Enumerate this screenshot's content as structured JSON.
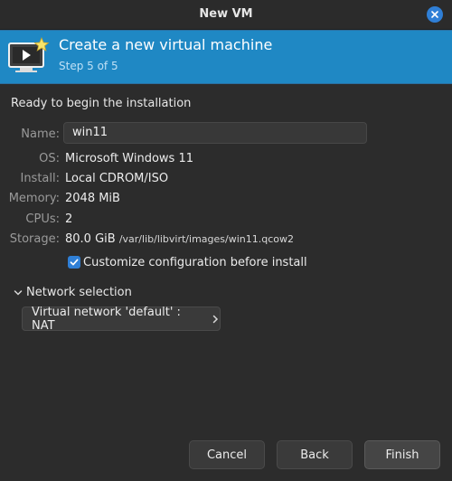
{
  "window": {
    "title": "New VM"
  },
  "banner": {
    "heading": "Create a new virtual machine",
    "step": "Step 5 of 5",
    "icon": "vm-screen-star-icon"
  },
  "summary": {
    "intro": "Ready to begin the installation",
    "name": {
      "label": "Name:",
      "value": "win11"
    },
    "os": {
      "label": "OS:",
      "value": "Microsoft Windows 11"
    },
    "install": {
      "label": "Install:",
      "value": "Local CDROM/ISO"
    },
    "memory": {
      "label": "Memory:",
      "value": "2048 MiB"
    },
    "cpus": {
      "label": "CPUs:",
      "value": "2"
    },
    "storage": {
      "label": "Storage:",
      "value": "80.0 GiB",
      "path": "/var/lib/libvirt/images/win11.qcow2"
    }
  },
  "customize": {
    "checked": true,
    "label": "Customize configuration before install"
  },
  "network": {
    "expander_label": "Network selection",
    "selected": "Virtual network 'default' : NAT"
  },
  "buttons": {
    "cancel": "Cancel",
    "back": "Back",
    "finish": "Finish"
  },
  "colors": {
    "banner": "#1f88c4",
    "accent": "#2f7fd6",
    "background": "#2c2c2c"
  }
}
